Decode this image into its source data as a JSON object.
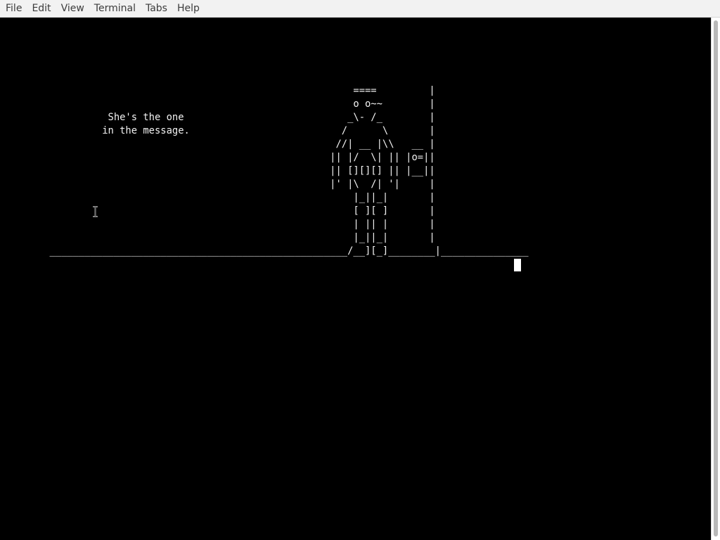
{
  "menubar": {
    "items": [
      "File",
      "Edit",
      "View",
      "Terminal",
      "Tabs",
      "Help"
    ]
  },
  "terminal": {
    "lines": [
      "",
      "",
      "",
      "",
      "",
      "                                                            ====         |",
      "                                                            o o~~        |",
      "                  She's the one                            _\\- /_        |",
      "                 in the message.                          /      \\       |",
      "                                                         //| __ |\\\\   __ |",
      "                                                        || |/  \\| || |o=||",
      "                                                        || [][][] || |__||",
      "                                                        |' |\\  /| '|     |",
      "                                                            |_||_|       |",
      "                                                            [ ][ ]       |",
      "                                                            | || |       |",
      "                                                            |_||_|       |",
      "        ___________________________________________________/__][_]________|_______________"
    ],
    "colors": {
      "background": "#000000",
      "foreground": "#f2f2f2"
    }
  },
  "icons": {
    "mouse_cursor": "ibeam-cursor-icon"
  }
}
